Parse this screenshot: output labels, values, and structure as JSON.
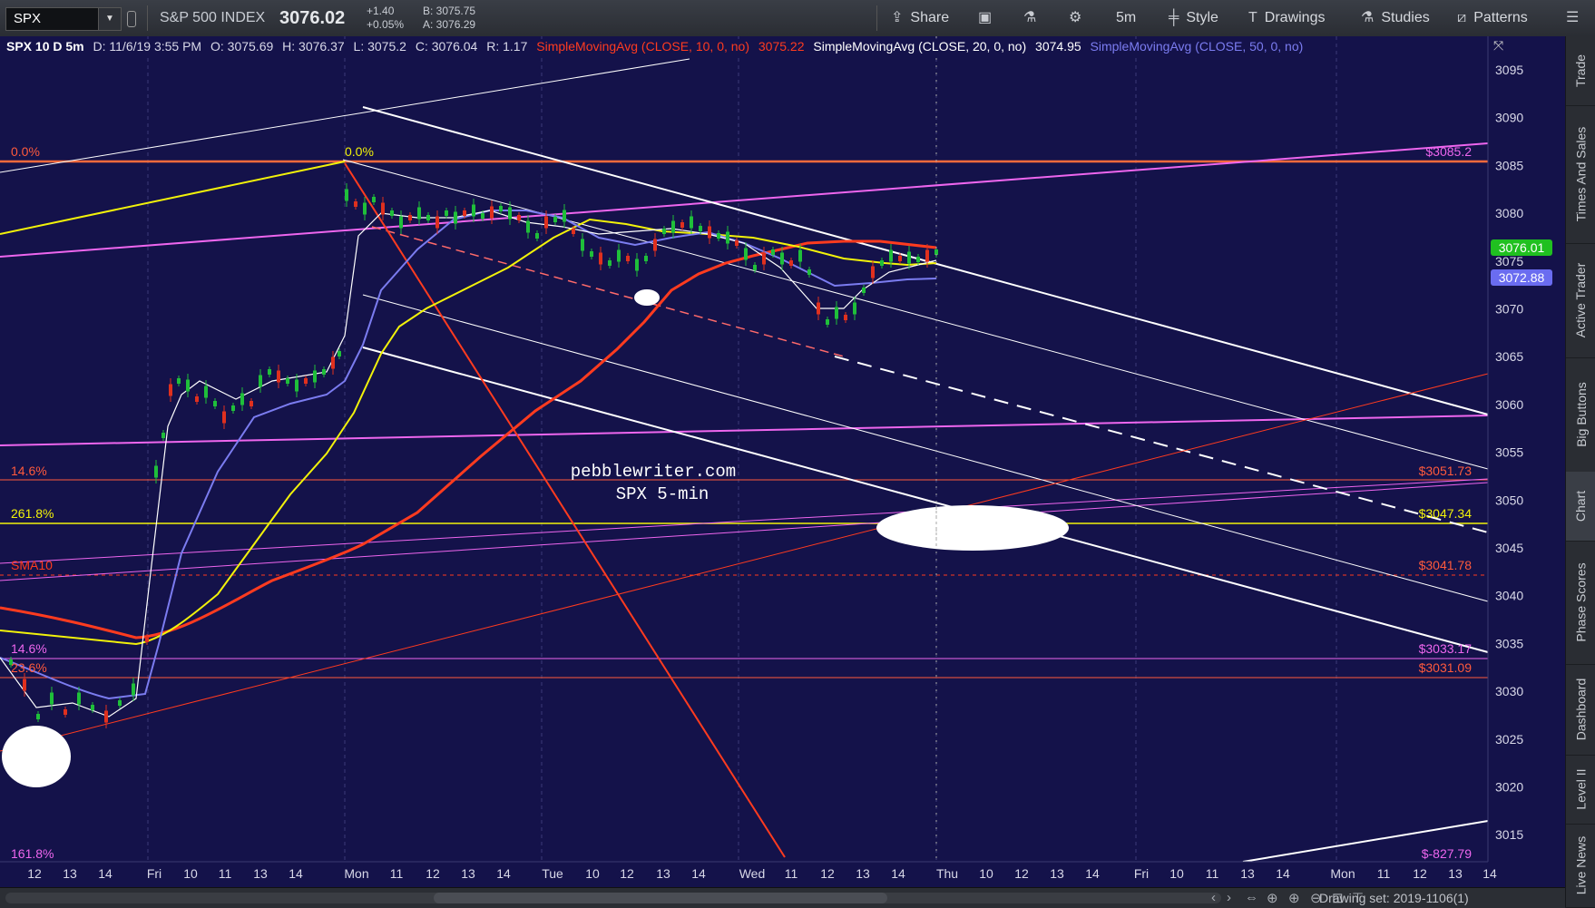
{
  "toolbar": {
    "symbol": "SPX",
    "index_name": "S&P 500 INDEX",
    "last": "3076.02",
    "change": "+1.40",
    "change_pct": "+0.05%",
    "bid": "B: 3075.75",
    "ask": "A: 3076.29",
    "share": "Share",
    "interval": "5m",
    "style": "Style",
    "drawings": "Drawings",
    "studies": "Studies",
    "patterns": "Patterns"
  },
  "legend": {
    "title": "SPX 10 D 5m",
    "date": "D: 11/6/19 3:55 PM",
    "open": "O: 3075.69",
    "high": "H: 3076.37",
    "low": "L: 3075.2",
    "close": "C: 3076.04",
    "range": "R: 1.17",
    "sma10": "SimpleMovingAvg (CLOSE, 10, 0, no)",
    "sma10_val": "3075.22",
    "sma20": "SimpleMovingAvg (CLOSE, 20, 0, no)",
    "sma20_val": "3074.95",
    "sma50": "SimpleMovingAvg (CLOSE, 50, 0, no)"
  },
  "price_axis": {
    "ticks": [
      "3095",
      "3090",
      "3085",
      "3080",
      "3075",
      "3070",
      "3065",
      "3060",
      "3055",
      "3050",
      "3045",
      "3040",
      "3035",
      "3030",
      "3025",
      "3020",
      "3015"
    ],
    "last_price_badge": "3076.01",
    "sma_badge": "3072.88"
  },
  "time_axis": {
    "labels": [
      "12",
      "13",
      "14",
      "Fri",
      "10",
      "11",
      "13",
      "14",
      "Mon",
      "11",
      "12",
      "13",
      "14",
      "Tue",
      "10",
      "12",
      "13",
      "14",
      "Wed",
      "11",
      "12",
      "13",
      "14",
      "Thu",
      "10",
      "12",
      "13",
      "14",
      "Fri",
      "10",
      "11",
      "13",
      "14",
      "Mon",
      "11",
      "12",
      "13",
      "14"
    ]
  },
  "annotations": {
    "fib_left_top": "0.0%",
    "fib_mid_top": "0.0%",
    "fib_146_a": "14.6%",
    "fib_2618": "261.8%",
    "sma10_label": "SMA10",
    "fib_146_b": "14.6%",
    "fib_236": "23.6%",
    "fib_1618": "161.8%",
    "price_3085": "$3085.2",
    "price_3051": "$3051.73",
    "price_3047": "$3047.34",
    "price_3041": "$3041.78",
    "price_3033": "$3033.17",
    "price_3031": "$3031.09",
    "price_neg": "$-827.79",
    "watermark_line1": "pebblewriter.com",
    "watermark_line2": "SPX 5-min"
  },
  "bottom": {
    "drawing_set": "Drawing set: 2019-1106(1)"
  },
  "sidebar": [
    "Trade",
    "Times And Sales",
    "Active Trader",
    "Big Buttons",
    "Chart",
    "Phase Scores",
    "Dashboard",
    "Level II",
    "Live News"
  ],
  "colors": {
    "chart_bg": "#14124a",
    "fib_red": "#ff5a3c",
    "sma_red": "#ff3b1f",
    "sma_yellow": "#f2f20a",
    "sma_blue": "#7b7cf0",
    "magenta": "#ee66ee",
    "up_candle": "#1fbf3a",
    "down_candle": "#e0301e",
    "last_badge": "#20c020",
    "sma_badge_bg": "#6a6cf0"
  }
}
